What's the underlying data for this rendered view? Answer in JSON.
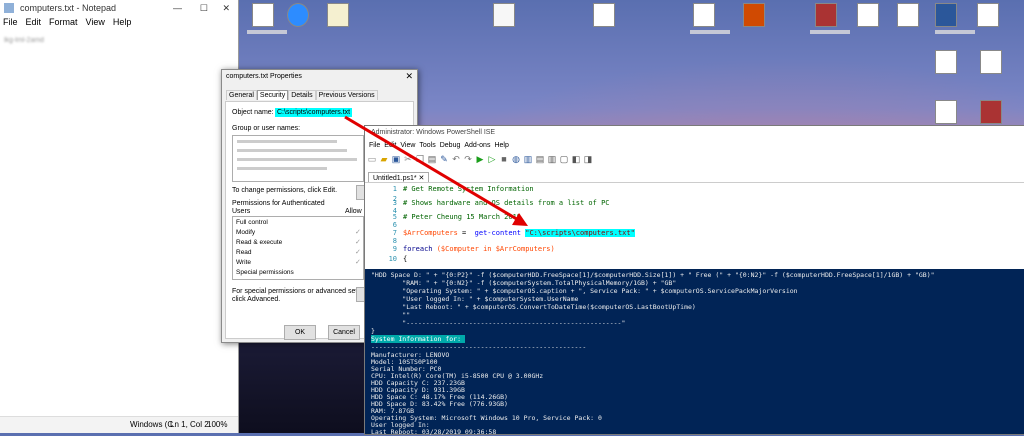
{
  "notepad": {
    "title": "computers.txt - Notepad",
    "menu": [
      "File",
      "Edit",
      "Format",
      "View",
      "Help"
    ],
    "content_line": "lkg-lml-2amd",
    "status": {
      "encoding": "Windows (C",
      "position": "Ln 1, Col 2",
      "zoom": "100%"
    }
  },
  "properties": {
    "title": "computers.txt Properties",
    "tabs": [
      "General",
      "Security",
      "Details",
      "Previous Versions"
    ],
    "object_name_label": "Object name:",
    "object_name_value": "C:\\scripts\\computers.txt",
    "group_label": "Group or user names:",
    "change_perm_text": "To change permissions, click Edit.",
    "perm_for_label": "Permissions for Authenticated",
    "users_label": "Users",
    "allow_label": "Allow",
    "permissions": [
      "Full control",
      "Modify",
      "Read & execute",
      "Read",
      "Write",
      "Special permissions"
    ],
    "special_text_1": "For special permissions or advanced settings,",
    "special_text_2": "click Advanced.",
    "ok": "OK",
    "cancel": "Cancel"
  },
  "ise": {
    "title": "Administrator: Windows PowerShell ISE",
    "menu": [
      "File",
      "Edit",
      "View",
      "Tools",
      "Debug",
      "Add-ons",
      "Help"
    ],
    "tab": "Untitled1.ps1*",
    "code": {
      "l1": "# Get Remote System Information",
      "l3": "# Shows hardware and OS details from a list of PC",
      "l5": "# Peter Cheung 15 March 2019",
      "l7_var": "$ArrComputers",
      "l7_eq": " =  ",
      "l7_cmd": "get-content ",
      "l7_str": "\"C:\\scripts\\computers.txt\"",
      "l9_kw": "foreach ",
      "l9_rest": "($Computer in $ArrComputers)",
      "l10": "{"
    },
    "console": [
      "\"HDD Space D: \" + \"{0:P2}\" -f ($computerHDD.FreeSpace[1]/$computerHDD.Size[1]) + \" Free (\" + \"{0:N2}\" -f ($computerHDD.FreeSpace[1]/1GB) + \"GB)\"",
      "        \"RAM: \" + \"{0:N2}\" -f ($computerSystem.TotalPhysicalMemory/1GB) + \"GB\"",
      "        \"Operating System: \" + $computerOS.caption + \", Service Pack: \" + $computerOS.ServicePackMajorVersion",
      "        \"User logged In: \" + $computerSystem.UserName",
      "        \"Last Reboot: \" + $computerOS.ConvertToDateTime($computerOS.LastBootUpTime)",
      "        \"\"",
      "        \"-------------------------------------------------------\"",
      "}"
    ],
    "sysinfo_header": "System Information for: ",
    "separator": "-------------------------------------------------------",
    "details": [
      "Manufacturer: LENOVO",
      "Model: 10STS0P100",
      "Serial Number: PC0",
      "CPU: Intel(R) Core(TM) i5-8500 CPU @ 3.00GHz",
      "HDD Capacity C: 237.23GB",
      "HDD Capacity D: 931.39GB",
      "HDD Space C: 48.17% Free (114.26GB)",
      "HDD Space D: 83.42% Free (776.93GB)",
      "RAM: 7.87GB",
      "Operating System: Microsoft Windows 10 Pro, Service Pack: 0",
      "User logged In: ",
      "Last Reboot: 03/28/2019 09:36:58"
    ]
  },
  "colors": {
    "highlight": "#00ffff",
    "arrow": "#e00000",
    "console_bg": "#012456"
  }
}
